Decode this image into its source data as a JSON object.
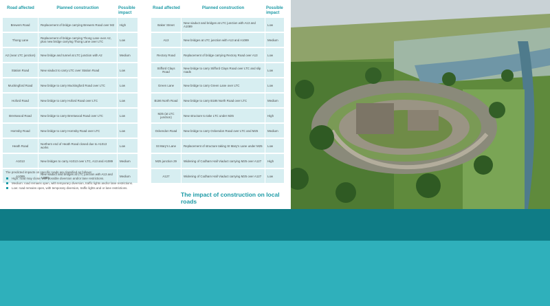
{
  "headers": {
    "road": "Road affected",
    "construction": "Planned construction",
    "impact": "Possible impact"
  },
  "left_rows": [
    {
      "road": "Brewers Road",
      "construction": "Replacement of bridge carrying Brewers Road over M2",
      "impact": "High"
    },
    {
      "road": "Thong Lane",
      "construction": "Replacement of bridge carrying Thong Lane over A2, plus new bridge carrying Thong Lane over LTC",
      "impact": "Low"
    },
    {
      "road": "A2 (near LTC junction)",
      "construction": "New bridge and tunnel at LTC junction with A2",
      "impact": "Medium"
    },
    {
      "road": "Station Road",
      "construction": "New viaduct to carry LTC over Station Road",
      "impact": "Low"
    },
    {
      "road": "Muckingford Road",
      "construction": "New bridge to carry Muckingford Road over LTC",
      "impact": "Low"
    },
    {
      "road": "Hoford Road",
      "construction": "New bridge to carry Hoford Road over LTC",
      "impact": "Low"
    },
    {
      "road": "Brentwood Road",
      "construction": "New bridge to carry Brentwood Road over LTC",
      "impact": "Low"
    },
    {
      "road": "Hornsby Road",
      "construction": "New bridge to carry Hornsby Road over LTC",
      "impact": "Low"
    },
    {
      "road": "Heath Road",
      "construction": "Northern end of Heath Road closed due to A1013 works",
      "impact": "Low"
    },
    {
      "road": "A1013",
      "construction": "New bridges to carry A1013 over LTC, A13 and A1089",
      "impact": "Medium"
    },
    {
      "road": "A1089",
      "construction": "New viaduct and bridges at LTC junction with A13 and A1089",
      "impact": "Medium"
    }
  ],
  "right_rows": [
    {
      "road": "Baker Street",
      "construction": "New viaduct and bridges at LTC junction with A13 and A1089",
      "impact": "Low"
    },
    {
      "road": "A13",
      "construction": "New bridges at LTC junction with A13 and A1089",
      "impact": "Medium"
    },
    {
      "road": "Rectory Road",
      "construction": "Replacement of bridge carrying Rectory Road over A13",
      "impact": "Low"
    },
    {
      "road": "Stifford Clays Road",
      "construction": "New bridge to carry Stifford Clays Road over LTC and slip roads",
      "impact": "Low"
    },
    {
      "road": "Green Lane",
      "construction": "New bridge to carry Green Lane over LTC",
      "impact": "Low"
    },
    {
      "road": "B186 North Road",
      "construction": "New bridge to carry B186 North Road over LTC",
      "impact": "Medium"
    },
    {
      "road": "M25 (at LTC junction)",
      "construction": "New structure to take LTC under M25",
      "impact": "High"
    },
    {
      "road": "Ockendon Road",
      "construction": "New bridge to carry Ockendon Road over LTC and M25",
      "impact": "Medium"
    },
    {
      "road": "St Mary's Lane",
      "construction": "Replacement of structure taking St Mary's Lane under M25",
      "impact": "Low"
    },
    {
      "road": "M25 junction 29",
      "construction": "Widening of Codham Hall Viaduct carrying M25 over A127",
      "impact": "High"
    },
    {
      "road": "A127",
      "construction": "Widening of Codham Hall Viaduct carrying M25 over A127",
      "impact": "Low"
    }
  ],
  "notes": {
    "intro": "The predicted impacts on specific roads are classified as follows:",
    "items": [
      "High: road may close, with possible diversion and/or lane restrictions.",
      "Medium: road remains open, with temporary diversion, traffic lights and/or lane restrictions.",
      "Low: road remains open, with temporary diversion, traffic lights and or lane restrictions."
    ]
  },
  "caption": "The impact of construction on local roads"
}
